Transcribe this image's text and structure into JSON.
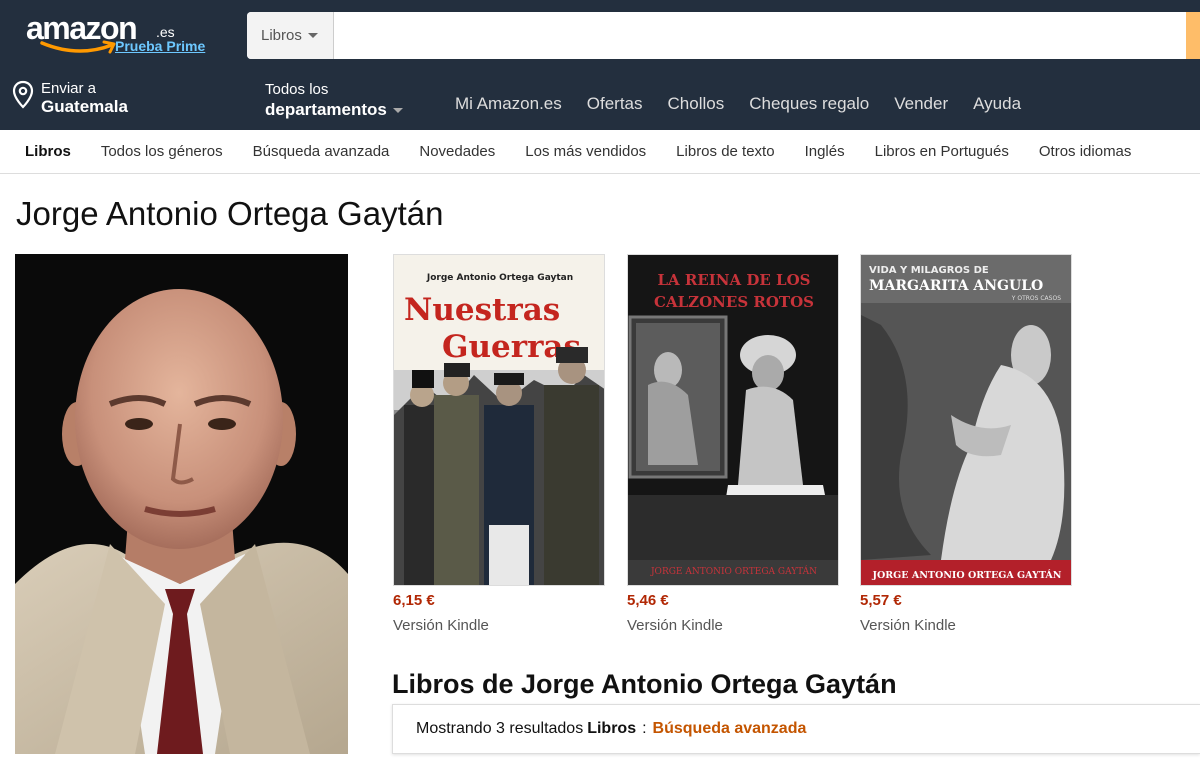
{
  "header": {
    "logo_text": "amazon",
    "logo_tld": ".es",
    "prime_link": "Prueba Prime",
    "search": {
      "category": "Libros",
      "value": "",
      "placeholder": ""
    }
  },
  "nav": {
    "deliver_line1": "Enviar a",
    "deliver_line2": "Guatemala",
    "departments_line1": "Todos los",
    "departments_line2": "departamentos",
    "links": [
      "Mi Amazon.es",
      "Ofertas",
      "Chollos",
      "Cheques regalo",
      "Vender",
      "Ayuda"
    ]
  },
  "subnav": {
    "items": [
      "Libros",
      "Todos los géneros",
      "Búsqueda avanzada",
      "Novedades",
      "Los más vendidos",
      "Libros de texto",
      "Inglés",
      "Libros en Portugués",
      "Otros idiomas"
    ]
  },
  "author": {
    "name": "Jorge Antonio Ortega Gaytán"
  },
  "books": [
    {
      "cover_author": "Jorge Antonio Ortega Gaytan",
      "cover_title_1": "Nuestras",
      "cover_title_2": "Guerras",
      "price": "6,15 €",
      "format": "Versión Kindle"
    },
    {
      "cover_title_1": "LA REINA DE LOS",
      "cover_title_2": "CALZONES ROTOS",
      "cover_author": "JORGE ANTONIO ORTEGA GAYTÁN",
      "price": "5,46 €",
      "format": "Versión Kindle"
    },
    {
      "cover_title_1": "VIDA Y MILAGROS DE",
      "cover_title_2": "MARGARITA ANGULO",
      "cover_title_3": "Y OTROS CASOS",
      "cover_author": "JORGE ANTONIO ORTEGA GAYTÁN",
      "price": "5,57 €",
      "format": "Versión Kindle"
    }
  ],
  "books_section": {
    "heading": "Libros de Jorge Antonio Ortega Gaytán",
    "results_prefix": "Mostrando 3 resultados",
    "results_category": "Libros",
    "results_sep": ":",
    "advanced_search": "Búsqueda avanzada"
  },
  "colors": {
    "header_bg": "#232f3e",
    "price": "#b12704",
    "link_orange": "#c45500",
    "prime_blue": "#6dc8ff"
  },
  "icons": {
    "location": "location-pin-icon",
    "dropdown": "caret-down-icon"
  }
}
